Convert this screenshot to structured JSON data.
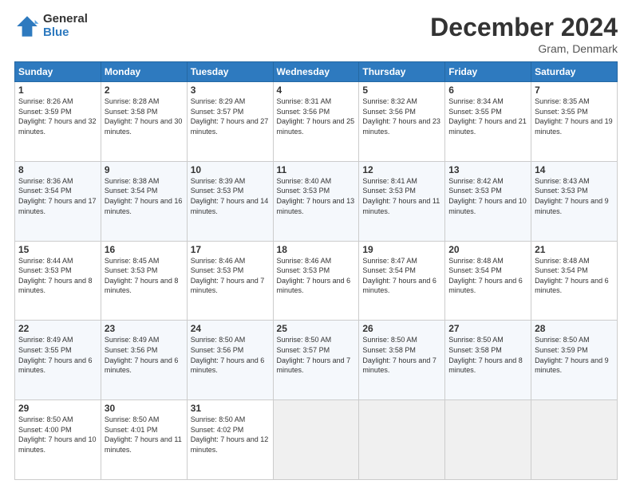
{
  "logo": {
    "general": "General",
    "blue": "Blue"
  },
  "title": "December 2024",
  "location": "Gram, Denmark",
  "days_header": [
    "Sunday",
    "Monday",
    "Tuesday",
    "Wednesday",
    "Thursday",
    "Friday",
    "Saturday"
  ],
  "weeks": [
    [
      {
        "day": "1",
        "sunrise": "Sunrise: 8:26 AM",
        "sunset": "Sunset: 3:59 PM",
        "daylight": "Daylight: 7 hours and 32 minutes."
      },
      {
        "day": "2",
        "sunrise": "Sunrise: 8:28 AM",
        "sunset": "Sunset: 3:58 PM",
        "daylight": "Daylight: 7 hours and 30 minutes."
      },
      {
        "day": "3",
        "sunrise": "Sunrise: 8:29 AM",
        "sunset": "Sunset: 3:57 PM",
        "daylight": "Daylight: 7 hours and 27 minutes."
      },
      {
        "day": "4",
        "sunrise": "Sunrise: 8:31 AM",
        "sunset": "Sunset: 3:56 PM",
        "daylight": "Daylight: 7 hours and 25 minutes."
      },
      {
        "day": "5",
        "sunrise": "Sunrise: 8:32 AM",
        "sunset": "Sunset: 3:56 PM",
        "daylight": "Daylight: 7 hours and 23 minutes."
      },
      {
        "day": "6",
        "sunrise": "Sunrise: 8:34 AM",
        "sunset": "Sunset: 3:55 PM",
        "daylight": "Daylight: 7 hours and 21 minutes."
      },
      {
        "day": "7",
        "sunrise": "Sunrise: 8:35 AM",
        "sunset": "Sunset: 3:55 PM",
        "daylight": "Daylight: 7 hours and 19 minutes."
      }
    ],
    [
      {
        "day": "8",
        "sunrise": "Sunrise: 8:36 AM",
        "sunset": "Sunset: 3:54 PM",
        "daylight": "Daylight: 7 hours and 17 minutes."
      },
      {
        "day": "9",
        "sunrise": "Sunrise: 8:38 AM",
        "sunset": "Sunset: 3:54 PM",
        "daylight": "Daylight: 7 hours and 16 minutes."
      },
      {
        "day": "10",
        "sunrise": "Sunrise: 8:39 AM",
        "sunset": "Sunset: 3:53 PM",
        "daylight": "Daylight: 7 hours and 14 minutes."
      },
      {
        "day": "11",
        "sunrise": "Sunrise: 8:40 AM",
        "sunset": "Sunset: 3:53 PM",
        "daylight": "Daylight: 7 hours and 13 minutes."
      },
      {
        "day": "12",
        "sunrise": "Sunrise: 8:41 AM",
        "sunset": "Sunset: 3:53 PM",
        "daylight": "Daylight: 7 hours and 11 minutes."
      },
      {
        "day": "13",
        "sunrise": "Sunrise: 8:42 AM",
        "sunset": "Sunset: 3:53 PM",
        "daylight": "Daylight: 7 hours and 10 minutes."
      },
      {
        "day": "14",
        "sunrise": "Sunrise: 8:43 AM",
        "sunset": "Sunset: 3:53 PM",
        "daylight": "Daylight: 7 hours and 9 minutes."
      }
    ],
    [
      {
        "day": "15",
        "sunrise": "Sunrise: 8:44 AM",
        "sunset": "Sunset: 3:53 PM",
        "daylight": "Daylight: 7 hours and 8 minutes."
      },
      {
        "day": "16",
        "sunrise": "Sunrise: 8:45 AM",
        "sunset": "Sunset: 3:53 PM",
        "daylight": "Daylight: 7 hours and 8 minutes."
      },
      {
        "day": "17",
        "sunrise": "Sunrise: 8:46 AM",
        "sunset": "Sunset: 3:53 PM",
        "daylight": "Daylight: 7 hours and 7 minutes."
      },
      {
        "day": "18",
        "sunrise": "Sunrise: 8:46 AM",
        "sunset": "Sunset: 3:53 PM",
        "daylight": "Daylight: 7 hours and 6 minutes."
      },
      {
        "day": "19",
        "sunrise": "Sunrise: 8:47 AM",
        "sunset": "Sunset: 3:54 PM",
        "daylight": "Daylight: 7 hours and 6 minutes."
      },
      {
        "day": "20",
        "sunrise": "Sunrise: 8:48 AM",
        "sunset": "Sunset: 3:54 PM",
        "daylight": "Daylight: 7 hours and 6 minutes."
      },
      {
        "day": "21",
        "sunrise": "Sunrise: 8:48 AM",
        "sunset": "Sunset: 3:54 PM",
        "daylight": "Daylight: 7 hours and 6 minutes."
      }
    ],
    [
      {
        "day": "22",
        "sunrise": "Sunrise: 8:49 AM",
        "sunset": "Sunset: 3:55 PM",
        "daylight": "Daylight: 7 hours and 6 minutes."
      },
      {
        "day": "23",
        "sunrise": "Sunrise: 8:49 AM",
        "sunset": "Sunset: 3:56 PM",
        "daylight": "Daylight: 7 hours and 6 minutes."
      },
      {
        "day": "24",
        "sunrise": "Sunrise: 8:50 AM",
        "sunset": "Sunset: 3:56 PM",
        "daylight": "Daylight: 7 hours and 6 minutes."
      },
      {
        "day": "25",
        "sunrise": "Sunrise: 8:50 AM",
        "sunset": "Sunset: 3:57 PM",
        "daylight": "Daylight: 7 hours and 7 minutes."
      },
      {
        "day": "26",
        "sunrise": "Sunrise: 8:50 AM",
        "sunset": "Sunset: 3:58 PM",
        "daylight": "Daylight: 7 hours and 7 minutes."
      },
      {
        "day": "27",
        "sunrise": "Sunrise: 8:50 AM",
        "sunset": "Sunset: 3:58 PM",
        "daylight": "Daylight: 7 hours and 8 minutes."
      },
      {
        "day": "28",
        "sunrise": "Sunrise: 8:50 AM",
        "sunset": "Sunset: 3:59 PM",
        "daylight": "Daylight: 7 hours and 9 minutes."
      }
    ],
    [
      {
        "day": "29",
        "sunrise": "Sunrise: 8:50 AM",
        "sunset": "Sunset: 4:00 PM",
        "daylight": "Daylight: 7 hours and 10 minutes."
      },
      {
        "day": "30",
        "sunrise": "Sunrise: 8:50 AM",
        "sunset": "Sunset: 4:01 PM",
        "daylight": "Daylight: 7 hours and 11 minutes."
      },
      {
        "day": "31",
        "sunrise": "Sunrise: 8:50 AM",
        "sunset": "Sunset: 4:02 PM",
        "daylight": "Daylight: 7 hours and 12 minutes."
      },
      null,
      null,
      null,
      null
    ]
  ]
}
